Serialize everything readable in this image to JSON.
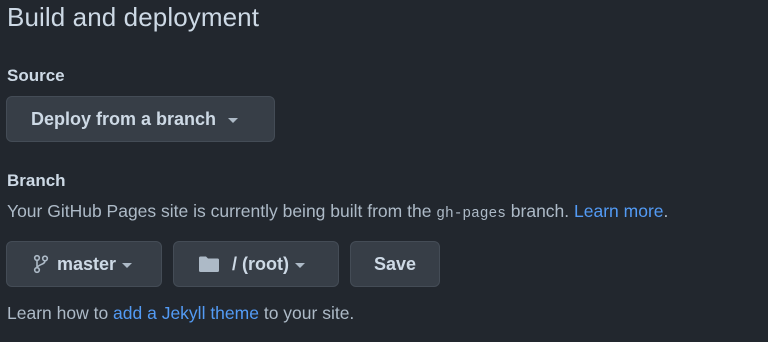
{
  "section": {
    "title": "Build and deployment"
  },
  "source": {
    "label": "Source",
    "selected": "Deploy from a branch"
  },
  "branch": {
    "label": "Branch",
    "description_prefix": "Your GitHub Pages site is currently being built from the ",
    "branch_code": "gh-pages",
    "description_suffix": " branch. ",
    "learn_more_link": "Learn more",
    "description_end": ".",
    "branch_selected": "master",
    "folder_selected": "/ (root)",
    "save_label": "Save",
    "branch_icon": "git-branch-icon",
    "folder_icon": "folder-icon"
  },
  "footer": {
    "prefix": "Learn how to ",
    "link": "add a Jekyll theme",
    "suffix": " to your site."
  },
  "colors": {
    "background": "#22272e",
    "button_bg": "#373e47",
    "button_border": "#444c56",
    "text": "#adbac7",
    "heading": "#cdd9e5",
    "link": "#539bf5"
  }
}
